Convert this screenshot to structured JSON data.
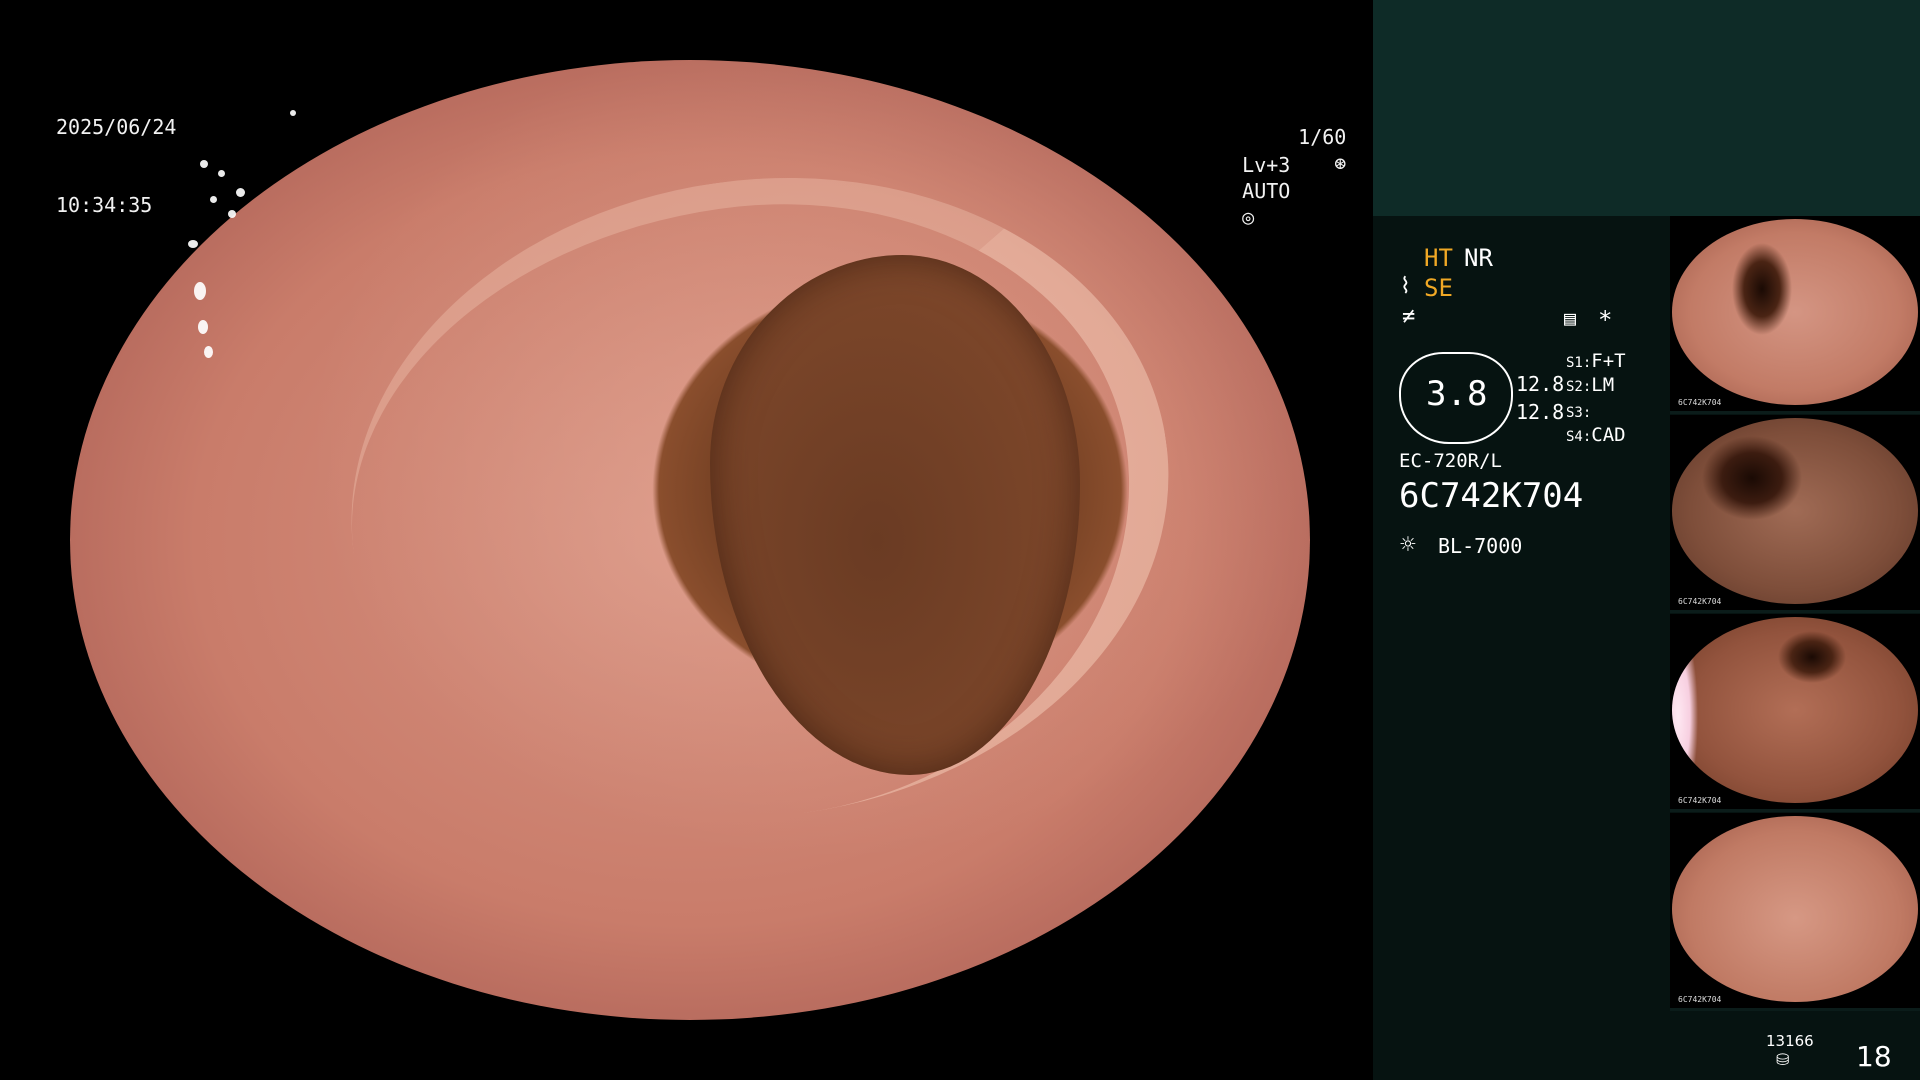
{
  "endoscope_view": {
    "date": "2025/06/24",
    "time": "10:34:35",
    "shutter": "1/60",
    "level": "Lv+3",
    "iris_mode": "AUTO"
  },
  "status_panel": {
    "ht_label": "HT",
    "nr_label": "NR",
    "se_label": "SE",
    "zoom_value": "3.8",
    "value_upper": "12.8",
    "value_lower": "12.8",
    "switch_s1_label": "S1:",
    "switch_s1_value": "F+T",
    "switch_s2_label": "S2:",
    "switch_s2_value": "LM",
    "switch_s3_label": "S3:",
    "switch_s3_value": "",
    "switch_s4_label": "S4:",
    "switch_s4_value": "CAD",
    "scope_model": "EC-720R/L",
    "scope_serial": "6C742K704",
    "light_source": "BL-7000",
    "star_symbol": "*",
    "storage_count": "13166",
    "image_count": "18"
  },
  "thumbnails": [
    {
      "caption": "6C742K704",
      "index": "17"
    },
    {
      "caption": "6C742K704",
      "index": "18"
    },
    {
      "caption": "6C742K704",
      "index": "15"
    },
    {
      "caption": "6C742K704",
      "index": "16"
    }
  ],
  "icons": {
    "shutter_icon": "aperture-icon",
    "iris_icon": "iris-icon",
    "light_icon": "sun-icon",
    "storage_icon": "disk-stack-icon",
    "memo_icon": "memo-icon",
    "enhancement_icon": "wave-icon",
    "freeze_icon": "no-equal-icon"
  },
  "colors": {
    "panel_background": "#061311",
    "panel_top_background": "#0e2b27",
    "highlight_amber": "#f0a825"
  }
}
